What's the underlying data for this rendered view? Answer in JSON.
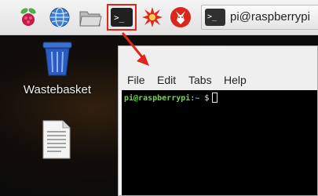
{
  "taskbar": {
    "launchers": [
      {
        "icon": "raspberry-pi-menu-icon"
      },
      {
        "icon": "web-browser-globe-icon"
      },
      {
        "icon": "file-manager-folder-icon"
      },
      {
        "icon": "terminal-icon",
        "glyph": ">_",
        "highlighted": true
      },
      {
        "icon": "mathematica-icon"
      },
      {
        "icon": "wolfram-icon"
      }
    ],
    "task_button": {
      "glyph": ">_",
      "label": "pi@raspberrypi"
    }
  },
  "desktop": {
    "items": [
      {
        "icon": "wastebasket-icon",
        "label": "Wastebasket"
      },
      {
        "icon": "text-file-icon",
        "label": ""
      }
    ]
  },
  "terminal": {
    "menu": [
      "File",
      "Edit",
      "Tabs",
      "Help"
    ],
    "prompt_user": "pi@raspberrypi",
    "prompt_sep": ":",
    "prompt_path": "~",
    "prompt_symbol": "$"
  },
  "colors": {
    "highlight": "#e0261b",
    "prompt_user": "#6fdb4a",
    "prompt_path": "#6aa7ff"
  }
}
